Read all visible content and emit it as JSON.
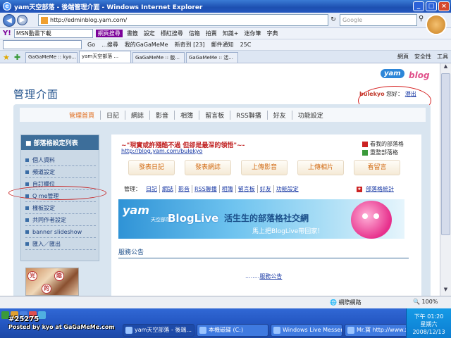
{
  "window": {
    "title": "yam天空部落 - 後端管理介面 - Windows Internet Explorer"
  },
  "address": {
    "url": "http://edminblog.yam.com/",
    "search_placeholder": "Google"
  },
  "yahoo_toolbar": {
    "logo": "Y!",
    "input": "MSN動畫下載",
    "search_btn": "網頁搜尋",
    "items": [
      "書籤",
      "設定",
      "標紅搜尋",
      "信箱",
      "拍賣",
      "知識+",
      "迷你筆",
      "字典"
    ]
  },
  "toolbar2": {
    "items": [
      "Go",
      "...搜尋",
      "我的GaGaMeMe",
      "新奇到 [23]",
      "郵件通知",
      "25C"
    ]
  },
  "tabs": [
    {
      "label": "GaGaMeMe :: kyo..."
    },
    {
      "label": "yam天空部落 ..."
    },
    {
      "label": "GaGaMeMe :: 版..."
    },
    {
      "label": "GaGaMeMe :: 活..."
    }
  ],
  "tab_tools": [
    "網頁",
    "安全性",
    "工具"
  ],
  "page": {
    "title": "管理介面",
    "user": {
      "name": "bulekyo",
      "greeting": "您好：",
      "logout": "澄出"
    },
    "nav": [
      "管理首頁",
      "日記",
      "網誌",
      "影音",
      "相簿",
      "留言板",
      "RSS聯播",
      "好友",
      "功能設定"
    ],
    "sidebar": {
      "header": "部落格設定列表",
      "items": [
        "個人資料",
        "頻道設定",
        "自訂欄位",
        "Q me管理",
        "樣板設定",
        "共同作者設定",
        "banner slideshow",
        "匯入／匯出"
      ]
    },
    "banner_chars": [
      "光",
      "陰",
      "的"
    ],
    "blog": {
      "title": "~\"現實或許殘酷不過 但卻是最深的領悟\"~-",
      "url": "http://blog.yam.com/bulekyo",
      "side_links": [
        "看我的部落格",
        "重整部落格"
      ],
      "buttons": [
        "發表日記",
        "發表網誌",
        "上傳影音",
        "上傳相片",
        "看留言"
      ],
      "manage_label": "管理：",
      "manage_links": [
        "日記",
        "網誌",
        "影音",
        "RSS聯播",
        "相簿",
        "留言板",
        "好友",
        "功能設定"
      ],
      "stats": "部落格統計"
    },
    "ad": {
      "yam": "yam",
      "sub": "天空部落",
      "brand": "BlogLive",
      "slogan": "活生生的部落格社交網",
      "sub2": "馬上把BlogLive帶回家！"
    },
    "notice": {
      "header": "服務公告",
      "prefix": "........",
      "link": "服務公告"
    }
  },
  "status": {
    "network": "網際網路",
    "zoom": "100%"
  },
  "taskbar": {
    "watermark": "#25275",
    "watermark2": "Posted by kyo at GaGaMeMe.com",
    "buttons": [
      "yam天空部落 - 後端...",
      "本機磁碟 (C:)",
      "Windows Live Messen...",
      "Mr.寶 http://www.xan..."
    ],
    "clock": {
      "time": "下午 01:20",
      "day": "星期六",
      "date": "2008/12/13"
    }
  }
}
